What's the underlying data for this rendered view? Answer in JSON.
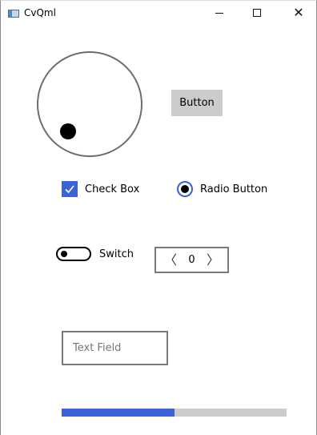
{
  "window": {
    "title": "CvQml",
    "minimize_glyph": "—",
    "maximize_glyph": "☐",
    "close_glyph": "✕"
  },
  "dial": {
    "value": 0
  },
  "button": {
    "label": "Button"
  },
  "checkbox": {
    "label": "Check Box",
    "checked": true
  },
  "radio": {
    "label": "Radio Button",
    "checked": true
  },
  "switch": {
    "label": "Switch",
    "on": false
  },
  "spinbox": {
    "value": "0",
    "decrement_glyph": "〈",
    "increment_glyph": "〉"
  },
  "text_field": {
    "placeholder": "Text Field",
    "value": ""
  },
  "progress": {
    "fraction": 0.5
  },
  "colors": {
    "accent": "#3a63d8",
    "track": "#cccccc",
    "button_bg": "#cccccc"
  }
}
